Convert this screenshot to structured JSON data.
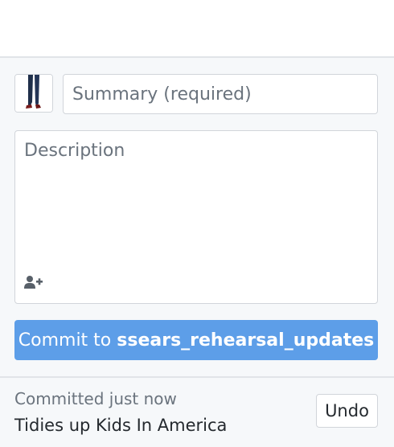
{
  "commit_form": {
    "avatar_icon": "user-avatar-icon",
    "summary_placeholder": "Summary (required)",
    "summary_value": "",
    "description_placeholder": "Description",
    "description_value": "",
    "coauthor_icon": "add-coauthor-icon",
    "commit_button": {
      "prefix": "Commit to",
      "branch": "ssears_rehearsal_updates"
    }
  },
  "undo": {
    "status": "Committed just now",
    "message": "Tidies up Kids In America",
    "button_label": "Undo"
  },
  "colors": {
    "accent": "#5d9ee8",
    "panel_background": "#f6f8fa",
    "border": "#d1d5da"
  }
}
